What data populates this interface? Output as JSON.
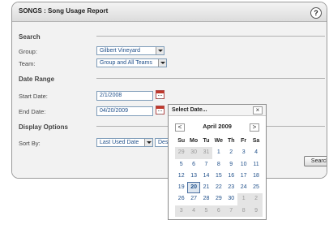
{
  "panel": {
    "title": "SONGS : Song Usage Report",
    "help_label": "?"
  },
  "sections": {
    "search": "Search",
    "date_range": "Date Range",
    "display_options": "Display Options"
  },
  "fields": {
    "group": {
      "label": "Group:",
      "value": "Gilbert Vineyard"
    },
    "team": {
      "label": "Team:",
      "value": "Group and All Teams"
    },
    "start_date": {
      "label": "Start Date:",
      "value": "2/1/2008"
    },
    "end_date": {
      "label": "End Date:",
      "value": "04/20/2009"
    },
    "sort_by": {
      "label": "Sort By:",
      "value": "Last Used Date",
      "second_value": "Des"
    }
  },
  "search_button": "Search",
  "date_picker": {
    "title": "Select Date...",
    "close_label": "×",
    "prev_label": "<",
    "next_label": ">",
    "month_label": "April 2009",
    "weekdays": [
      "Su",
      "Mo",
      "Tu",
      "We",
      "Th",
      "Fr",
      "Sa"
    ],
    "weeks": [
      [
        {
          "d": "29",
          "o": true
        },
        {
          "d": "30",
          "o": true
        },
        {
          "d": "31",
          "o": true
        },
        {
          "d": "1"
        },
        {
          "d": "2"
        },
        {
          "d": "3"
        },
        {
          "d": "4"
        }
      ],
      [
        {
          "d": "5"
        },
        {
          "d": "6"
        },
        {
          "d": "7"
        },
        {
          "d": "8"
        },
        {
          "d": "9"
        },
        {
          "d": "10"
        },
        {
          "d": "11"
        }
      ],
      [
        {
          "d": "12"
        },
        {
          "d": "13"
        },
        {
          "d": "14"
        },
        {
          "d": "15"
        },
        {
          "d": "16"
        },
        {
          "d": "17"
        },
        {
          "d": "18"
        }
      ],
      [
        {
          "d": "19"
        },
        {
          "d": "20",
          "t": true
        },
        {
          "d": "21"
        },
        {
          "d": "22"
        },
        {
          "d": "23"
        },
        {
          "d": "24"
        },
        {
          "d": "25"
        }
      ],
      [
        {
          "d": "26"
        },
        {
          "d": "27"
        },
        {
          "d": "28"
        },
        {
          "d": "29"
        },
        {
          "d": "30"
        },
        {
          "d": "1",
          "o": true
        },
        {
          "d": "2",
          "o": true
        }
      ],
      [
        {
          "d": "3",
          "o": true
        },
        {
          "d": "4",
          "o": true
        },
        {
          "d": "5",
          "o": true
        },
        {
          "d": "6",
          "o": true
        },
        {
          "d": "7",
          "o": true
        },
        {
          "d": "8",
          "o": true
        },
        {
          "d": "9",
          "o": true
        }
      ]
    ]
  }
}
